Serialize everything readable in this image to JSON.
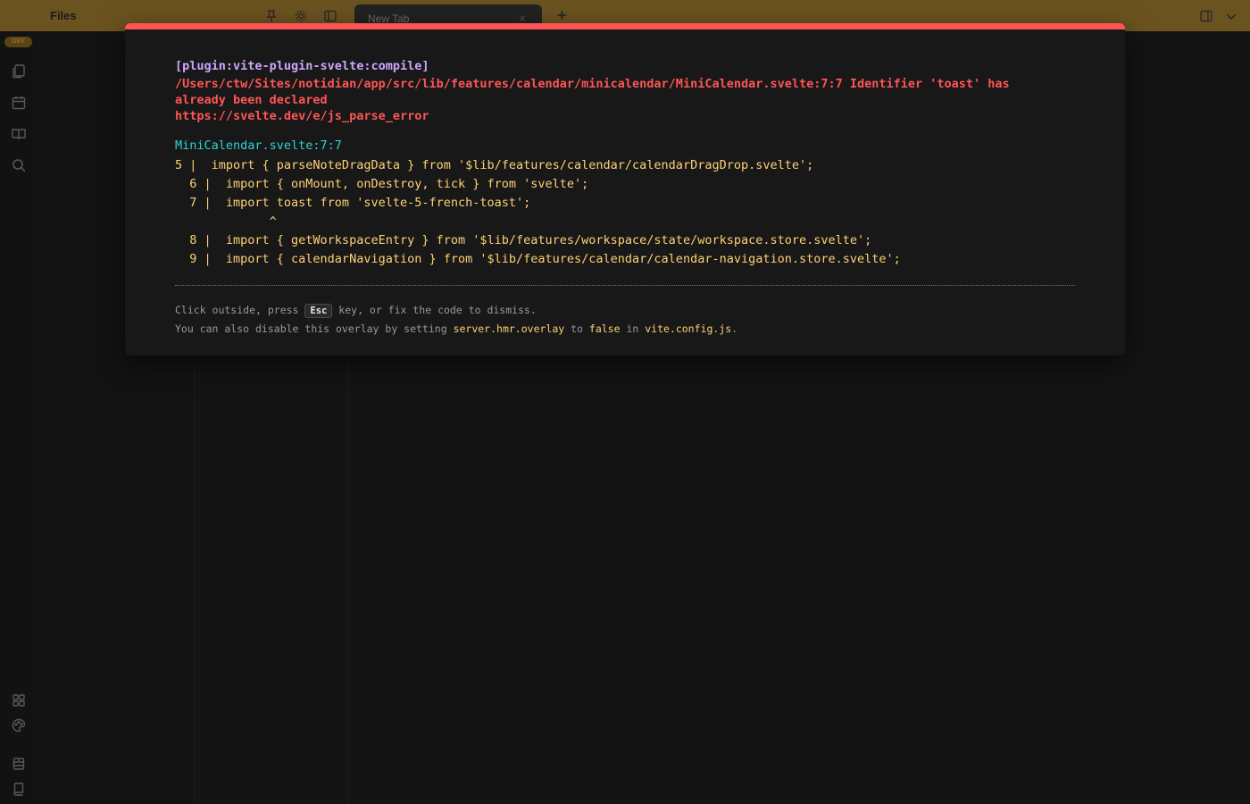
{
  "app": {
    "sidebar_title": "Files",
    "dev_badge": "DEV",
    "tab": {
      "label": "New Tab",
      "close": "×"
    },
    "new_tab_label": "+"
  },
  "ribbon_icons": [
    "files-icon",
    "calendar-icon",
    "book-icon",
    "search-icon",
    "layout-grid-icon",
    "palette-icon",
    "archive-icon",
    "book-closed-icon"
  ],
  "error_overlay": {
    "plugin": "[plugin:vite-plugin-svelte:compile]",
    "message": "/Users/ctw/Sites/notidian/app/src/lib/features/calendar/minicalendar/MiniCalendar.svelte:7:7 Identifier 'toast' has\nalready been declared\nhttps://svelte.dev/e/js_parse_error",
    "file": "MiniCalendar.svelte:7:7",
    "frame": "5 |  import { parseNoteDragData } from '$lib/features/calendar/calendarDragDrop.svelte';\n  6 |  import { onMount, onDestroy, tick } from 'svelte';\n  7 |  import toast from 'svelte-5-french-toast';\n             ^\n  8 |  import { getWorkspaceEntry } from '$lib/features/workspace/state/workspace.store.svelte';\n  9 |  import { calendarNavigation } from '$lib/features/calendar/calendar-navigation.store.svelte';",
    "tip1": {
      "before": "Click outside, press ",
      "key": "Esc",
      "after": " key, or fix the code to dismiss."
    },
    "tip2": {
      "before": "You can also disable this overlay by setting ",
      "setting": "server.hmr.overlay",
      "mid1": " to ",
      "value": "false",
      "mid2": " in ",
      "config": "vite.config.js",
      "end": "."
    }
  },
  "colors": {
    "accent_bar": "#ff5555",
    "plugin": "#cfa6ff",
    "file": "#2dd4d4",
    "frame": "#ffd175",
    "topbar": "#6b5320"
  }
}
